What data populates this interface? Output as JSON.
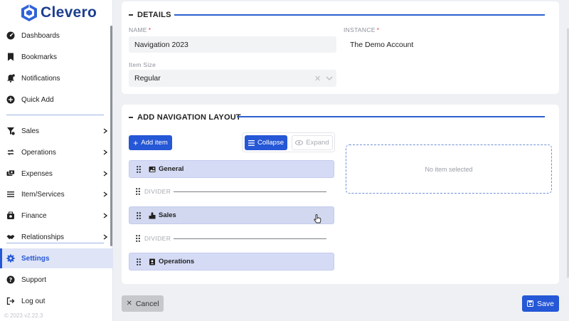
{
  "app": {
    "name": "Clevero",
    "version": "© 2023  v2.22.3",
    "brand_color": "#2557d6"
  },
  "sidebar": {
    "items": [
      {
        "label": "Dashboards",
        "icon": "dashboard-icon",
        "has_chevron": false
      },
      {
        "label": "Bookmarks",
        "icon": "bookmark-icon",
        "has_chevron": false
      },
      {
        "label": "Notifications",
        "icon": "bell-icon",
        "has_chevron": false
      },
      {
        "label": "Quick Add",
        "icon": "plus-circle-icon",
        "has_chevron": false
      },
      {
        "label": "Sales",
        "icon": "sales-icon",
        "has_chevron": true
      },
      {
        "label": "Operations",
        "icon": "operations-icon",
        "has_chevron": true
      },
      {
        "label": "Expenses",
        "icon": "expenses-icon",
        "has_chevron": true
      },
      {
        "label": "Item/Services",
        "icon": "list-icon",
        "has_chevron": true
      },
      {
        "label": "Finance",
        "icon": "finance-icon",
        "has_chevron": true
      },
      {
        "label": "Relationships",
        "icon": "handshake-icon",
        "has_chevron": true
      },
      {
        "label": "Settings",
        "icon": "gear-icon",
        "has_chevron": false,
        "active": true
      },
      {
        "label": "Support",
        "icon": "help-icon",
        "has_chevron": false
      },
      {
        "label": "Log out",
        "icon": "logout-icon",
        "has_chevron": false
      }
    ]
  },
  "details": {
    "title": "DETAILS",
    "name_label": "NAME",
    "name_value": "Navigation 2023",
    "instance_label": "INSTANCE",
    "instance_value": "The Demo Account",
    "size_label": "Item Size",
    "size_value": "Regular"
  },
  "layout": {
    "title": "ADD NAVIGATION LAYOUT",
    "add_item": "Add item",
    "collapse": "Collapse",
    "expand": "Expand",
    "rows": [
      {
        "type": "item",
        "label": "General",
        "icon": "image-icon"
      },
      {
        "type": "divider",
        "label": "DIVIDER"
      },
      {
        "type": "item",
        "label": "Sales",
        "icon": "sales-chart-icon"
      },
      {
        "type": "divider",
        "label": "DIVIDER"
      },
      {
        "type": "item",
        "label": "Operations",
        "icon": "contact-book-icon"
      }
    ],
    "empty_text": "No item selected"
  },
  "footer": {
    "cancel": "Cancel",
    "save": "Save"
  }
}
